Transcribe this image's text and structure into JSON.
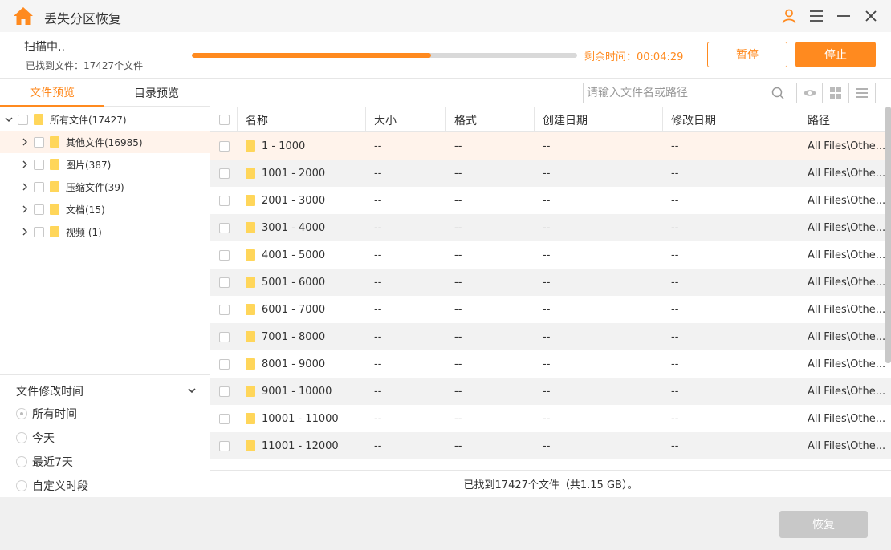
{
  "app": {
    "title": "丢失分区恢复"
  },
  "scan": {
    "status": "扫描中..",
    "found": "已找到文件：17427个文件",
    "progress": 0.62,
    "remaining": "剩余时间：00:04:29",
    "pause_label": "暂停",
    "stop_label": "停止"
  },
  "tabs": [
    {
      "label": "文件预览"
    },
    {
      "label": "目录预览"
    }
  ],
  "tree": {
    "root": "所有文件(17427)",
    "items": [
      {
        "label": "其他文件(16985)"
      },
      {
        "label": "图片(387)"
      },
      {
        "label": "压缩文件(39)"
      },
      {
        "label": "文档(15)"
      },
      {
        "label": "视频 (1)"
      }
    ]
  },
  "filter": {
    "title": "文件修改时间",
    "options": [
      {
        "label": "所有时间",
        "selected": true
      },
      {
        "label": "今天"
      },
      {
        "label": "最近7天"
      },
      {
        "label": "自定义时段"
      }
    ]
  },
  "search": {
    "placeholder": "请输入文件名或路径"
  },
  "table": {
    "columns": [
      "名称",
      "大小",
      "格式",
      "创建日期",
      "修改日期",
      "路径"
    ],
    "rows": [
      {
        "name": "1 - 1000",
        "size": "--",
        "format": "--",
        "created": "--",
        "modified": "--",
        "path": "All Files\\Othe..."
      },
      {
        "name": "1001 - 2000",
        "size": "--",
        "format": "--",
        "created": "--",
        "modified": "--",
        "path": "All Files\\Othe..."
      },
      {
        "name": "2001 - 3000",
        "size": "--",
        "format": "--",
        "created": "--",
        "modified": "--",
        "path": "All Files\\Othe..."
      },
      {
        "name": "3001 - 4000",
        "size": "--",
        "format": "--",
        "created": "--",
        "modified": "--",
        "path": "All Files\\Othe..."
      },
      {
        "name": "4001 - 5000",
        "size": "--",
        "format": "--",
        "created": "--",
        "modified": "--",
        "path": "All Files\\Othe..."
      },
      {
        "name": "5001 - 6000",
        "size": "--",
        "format": "--",
        "created": "--",
        "modified": "--",
        "path": "All Files\\Othe..."
      },
      {
        "name": "6001 - 7000",
        "size": "--",
        "format": "--",
        "created": "--",
        "modified": "--",
        "path": "All Files\\Othe..."
      },
      {
        "name": "7001 - 8000",
        "size": "--",
        "format": "--",
        "created": "--",
        "modified": "--",
        "path": "All Files\\Othe..."
      },
      {
        "name": "8001 - 9000",
        "size": "--",
        "format": "--",
        "created": "--",
        "modified": "--",
        "path": "All Files\\Othe..."
      },
      {
        "name": "9001 - 10000",
        "size": "--",
        "format": "--",
        "created": "--",
        "modified": "--",
        "path": "All Files\\Othe..."
      },
      {
        "name": "10001 - 11000",
        "size": "--",
        "format": "--",
        "created": "--",
        "modified": "--",
        "path": "All Files\\Othe..."
      },
      {
        "name": "11001 - 12000",
        "size": "--",
        "format": "--",
        "created": "--",
        "modified": "--",
        "path": "All Files\\Othe..."
      }
    ]
  },
  "status_line": "已找到17427个文件（共1.15 GB）。",
  "footer": {
    "recover_label": "恢复"
  },
  "colors": {
    "accent": "#ff8a1f",
    "selected_row": "#fff3eb",
    "alt_row": "#f2f2f2"
  }
}
